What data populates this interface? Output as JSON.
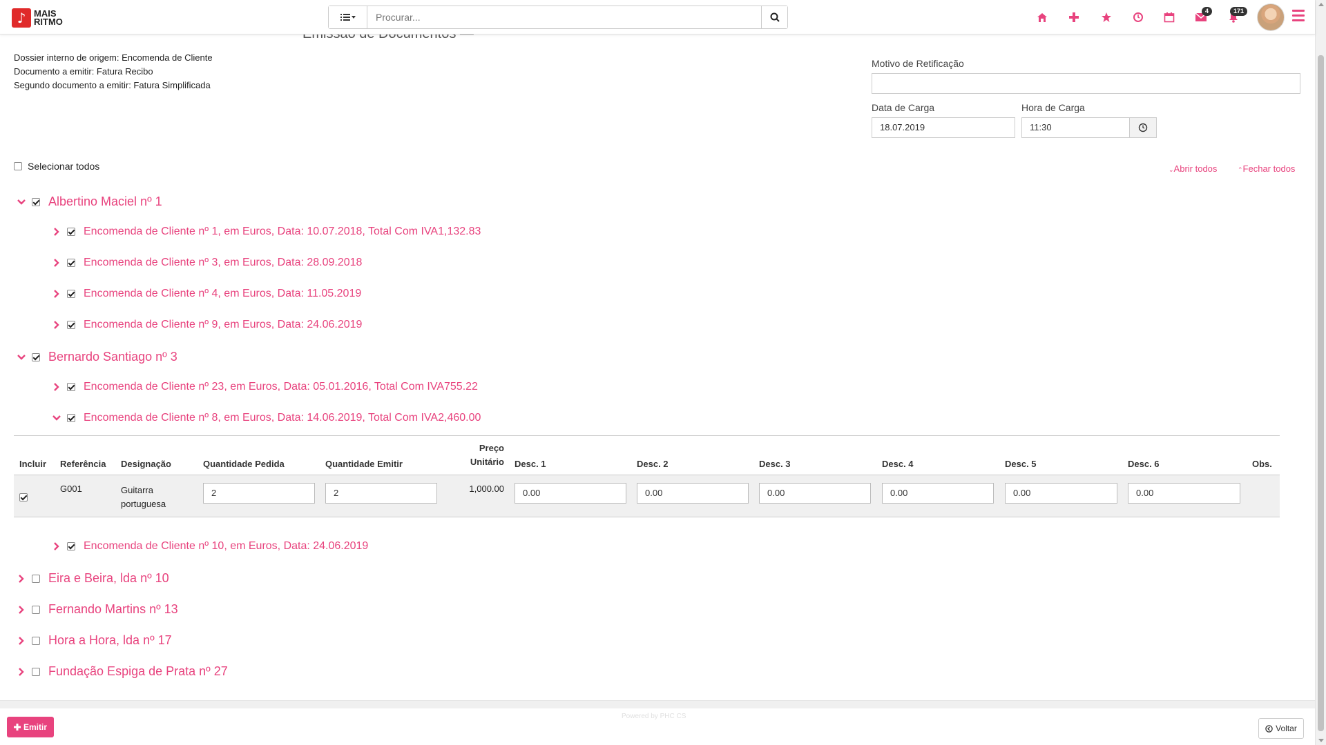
{
  "app": {
    "logo_line1": "MAIS",
    "logo_line2": "RITMO",
    "logo_glyph": "♪"
  },
  "search": {
    "placeholder": "Procurar..."
  },
  "header_badges": {
    "messages": "4",
    "notifications": "171"
  },
  "heading_partial": "Emissão de Documentos — Integração de Encomendas por Expedição",
  "info": {
    "line1": "Dossier interno de origem: Encomenda de Cliente",
    "line2": "Documento a emitir: Fatura Recibo",
    "line3": "Segundo documento a emitir: Fatura Simplificada"
  },
  "form": {
    "motivo_label": "Motivo de Retificação",
    "motivo_value": "",
    "data_label": "Data de Carga",
    "data_value": "18.07.2019",
    "hora_label": "Hora de Carga",
    "hora_value": "11:30"
  },
  "select_all_label": "Selecionar todos",
  "links": {
    "open_all": "Abrir todos",
    "close_all": "Fechar todos"
  },
  "tree": {
    "c1": {
      "label": "Albertino Maciel nº 1",
      "checked": true,
      "expanded": true,
      "orders": [
        {
          "label": "Encomenda de Cliente nº 1, em Euros, Data: 10.07.2018, Total Com IVA1,132.83"
        },
        {
          "label": "Encomenda de Cliente nº 3, em Euros, Data: 28.09.2018"
        },
        {
          "label": "Encomenda de Cliente nº 4, em Euros, Data: 11.05.2019"
        },
        {
          "label": "Encomenda de Cliente nº 9, em Euros, Data: 24.06.2019"
        }
      ]
    },
    "c2": {
      "label": "Bernardo Santiago nº 3",
      "checked": true,
      "expanded": true,
      "orders": [
        {
          "label": "Encomenda de Cliente nº 23, em Euros, Data: 05.01.2016, Total Com IVA755.22"
        },
        {
          "label": "Encomenda de Cliente nº 8, em Euros, Data: 14.06.2019, Total Com IVA2,460.00"
        },
        {
          "label": "Encomenda de Cliente nº 10, em Euros, Data: 24.06.2019"
        }
      ]
    },
    "c3": {
      "label": "Eira e Beira, lda nº 10"
    },
    "c4": {
      "label": "Fernando Martins nº 13"
    },
    "c5": {
      "label": "Hora a Hora, lda nº 17"
    },
    "c6": {
      "label": "Fundação Espiga de Prata nº 27"
    }
  },
  "table": {
    "headers": {
      "incluir": "Incluir",
      "referencia": "Referência",
      "designacao": "Designação",
      "qtd_pedida": "Quantidade Pedida",
      "qtd_emitir": "Quantidade Emitir",
      "preco_1": "Preço",
      "preco_2": "Unitário",
      "d1": "Desc. 1",
      "d2": "Desc. 2",
      "d3": "Desc. 3",
      "d4": "Desc. 4",
      "d5": "Desc. 5",
      "d6": "Desc. 6",
      "obs": "Obs."
    },
    "row": {
      "ref": "G001",
      "desig_1": "Guitarra",
      "desig_2": "portuguesa",
      "qtd_pedida": "2",
      "qtd_emitir": "2",
      "preco": "1,000.00",
      "d1": "0.00",
      "d2": "0.00",
      "d3": "0.00",
      "d4": "0.00",
      "d5": "0.00",
      "d6": "0.00"
    }
  },
  "footer": {
    "emit": "Emitir",
    "back": "Voltar",
    "powered": "Powered by PHC CS"
  },
  "colors": {
    "accent": "#e8437e",
    "logo": "#e02a2a"
  }
}
